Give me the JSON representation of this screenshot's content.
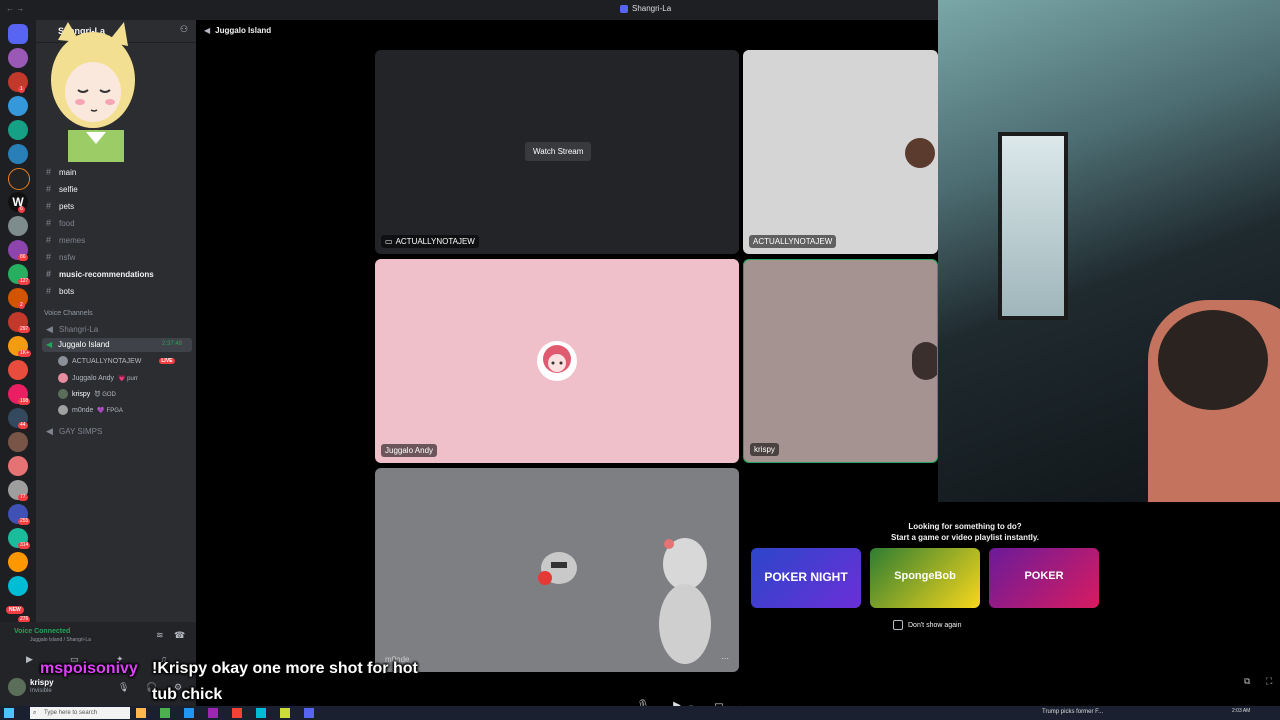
{
  "window": {
    "title": "Shangri-La"
  },
  "sidebar": {
    "server_name": "Shangri-La",
    "text_channels": [
      {
        "name": "main",
        "unread": true
      },
      {
        "name": "selfie",
        "unread": true
      },
      {
        "name": "pets",
        "unread": true
      },
      {
        "name": "food",
        "unread": false
      },
      {
        "name": "memes",
        "unread": false
      },
      {
        "name": "nsfw",
        "unread": false
      },
      {
        "name": "music-recommendations",
        "unread": true
      },
      {
        "name": "bots",
        "unread": true
      }
    ],
    "voice_header": "Voice Channels",
    "voice_channels": [
      {
        "name": "Shangri-La",
        "active": false
      },
      {
        "name": "Juggalo Island",
        "active": true,
        "timer": "2:37:48"
      },
      {
        "name": "GAY SIMPS",
        "active": false
      }
    ],
    "voice_users": [
      {
        "name": "ACTUALLYNOTAJEW",
        "tag": "LIVE",
        "color": "#8a8f98"
      },
      {
        "name": "Juggalo Andy",
        "tag": "💗 purr",
        "color": "#e88ca0"
      },
      {
        "name": "krispy",
        "tag": "😈 GOD",
        "color": "#5a6e5a"
      },
      {
        "name": "m0nde",
        "tag": "💜 FPGA",
        "color": "#a0a0a0"
      }
    ]
  },
  "rail_badges": [
    "1",
    "6",
    "86",
    "127",
    "2",
    "297",
    "1K+",
    "198",
    "44",
    "77",
    "255",
    "314",
    "276"
  ],
  "user_panel": {
    "status": "Voice Connected",
    "location": "Juggalo Island / Shangri-La",
    "username": "krispy",
    "user_status": "Invisible",
    "new_badge": "NEW"
  },
  "header": {
    "channel": "Juggalo Island"
  },
  "tiles": [
    {
      "label": "ACTUALLYNOTAJEW",
      "kind": "stream",
      "button": "Watch Stream"
    },
    {
      "label": "ACTUALLYNOTAJEW",
      "kind": "camera"
    },
    {
      "label": "Juggalo Andy",
      "kind": "avatar"
    },
    {
      "label": "krispy",
      "kind": "avatar"
    },
    {
      "label": "m0nde",
      "kind": "avatar"
    }
  ],
  "activity": {
    "line1": "Looking for something to do?",
    "line2": "Start a game or video playlist instantly.",
    "games": [
      "POKER NIGHT",
      "SpongeBob",
      "POKER"
    ],
    "checkbox_label": "Don't show again"
  },
  "caption": {
    "user": "mspoisonivy",
    "text": "!Krispy okay one more shot for hot",
    "text2": "tub chick"
  },
  "taskbar": {
    "search_placeholder": "Type here to search",
    "news": "Trump picks former F...",
    "time": "2:03 AM"
  }
}
